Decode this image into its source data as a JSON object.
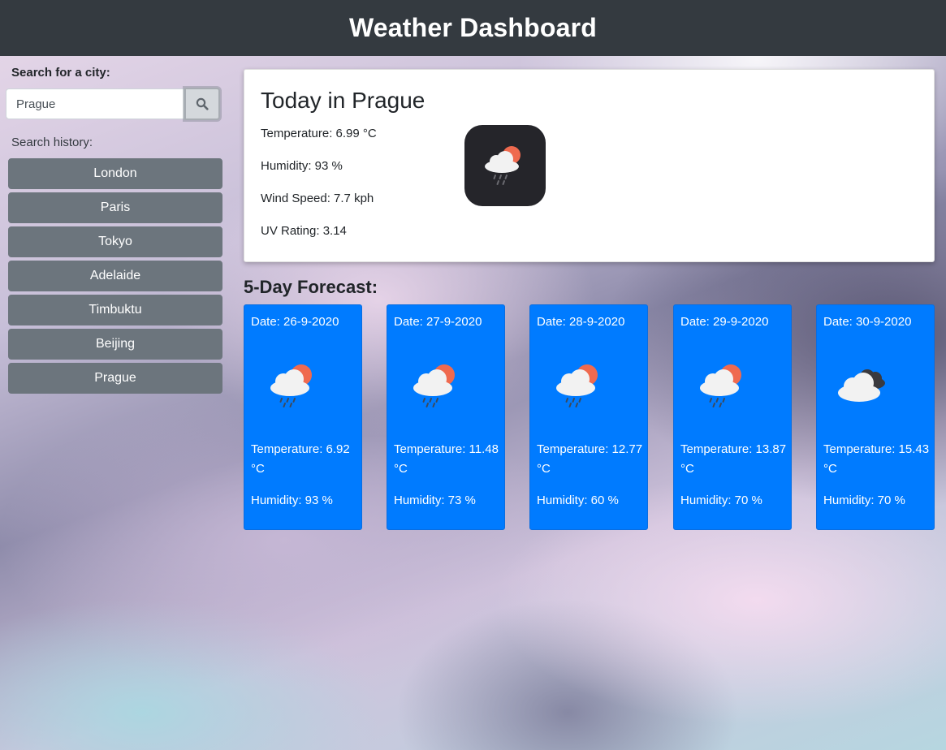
{
  "header": {
    "title": "Weather Dashboard"
  },
  "sidebar": {
    "search_label": "Search for a city:",
    "search_value": "Prague",
    "search_button_icon": "search-icon",
    "history_label": "Search history:",
    "history": [
      "London",
      "Paris",
      "Tokyo",
      "Adelaide",
      "Timbuktu",
      "Beijing",
      "Prague"
    ]
  },
  "today": {
    "title": "Today in Prague",
    "temperature": "Temperature: 6.99 °C",
    "humidity": "Humidity: 93 %",
    "wind": "Wind Speed: 7.7 kph",
    "uv": "UV Rating: 3.14",
    "icon": "sun-cloud-rain-icon"
  },
  "forecast": {
    "title": "5-Day Forecast:",
    "days": [
      {
        "date": "Date: 26-9-2020",
        "temperature": "Temperature: 6.92 °C",
        "humidity": "Humidity: 93 %",
        "icon": "sun-cloud-rain-icon"
      },
      {
        "date": "Date: 27-9-2020",
        "temperature": "Temperature: 11.48 °C",
        "humidity": "Humidity: 73 %",
        "icon": "sun-cloud-rain-icon"
      },
      {
        "date": "Date: 28-9-2020",
        "temperature": "Temperature: 12.77 °C",
        "humidity": "Humidity: 60 %",
        "icon": "sun-cloud-rain-icon"
      },
      {
        "date": "Date: 29-9-2020",
        "temperature": "Temperature: 13.87 °C",
        "humidity": "Humidity: 70 %",
        "icon": "sun-cloud-rain-icon"
      },
      {
        "date": "Date: 30-9-2020",
        "temperature": "Temperature: 15.43 °C",
        "humidity": "Humidity: 70 %",
        "icon": "clouds-icon"
      }
    ]
  },
  "colors": {
    "header_bg": "#343a40",
    "history_button": "#6c757d",
    "forecast_card": "#007bff",
    "sun": "#ef6a4f",
    "cloud": "#f2f2f2",
    "dark_cloud": "#3a3a3f"
  }
}
